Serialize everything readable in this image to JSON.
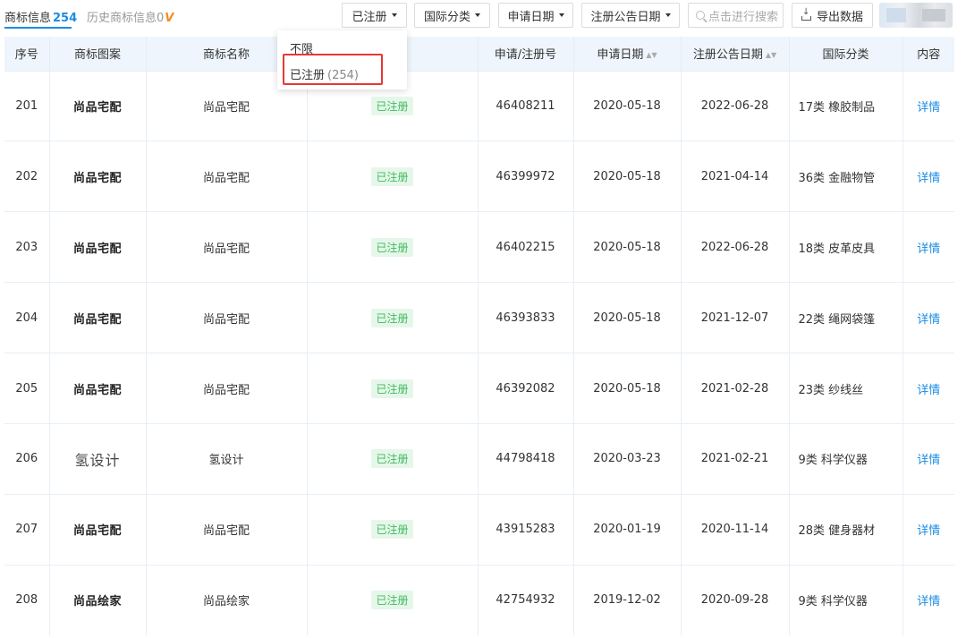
{
  "tabs": {
    "active_label": "商标信息",
    "active_count": "254",
    "history_label": "历史商标信息0",
    "vip_label": "V"
  },
  "toolbar": {
    "status_filter": "已注册",
    "class_filter": "国际分类",
    "apply_date_filter": "申请日期",
    "pub_date_filter": "注册公告日期",
    "search_placeholder": "点击进行搜索",
    "export_label": "导出数据"
  },
  "status_dropdown": {
    "options": [
      {
        "label": "不限",
        "count": ""
      },
      {
        "label": "已注册",
        "count": "(254)"
      }
    ]
  },
  "table": {
    "columns": [
      "序号",
      "商标图案",
      "商标名称",
      "状态",
      "申请/注册号",
      "申请日期",
      "注册公告日期",
      "国际分类",
      "内容"
    ],
    "status_col_visible": "态",
    "rows": [
      {
        "index": "201",
        "logo": "尚品宅配",
        "name": "尚品宅配",
        "status": "已注册",
        "reg_no": "46408211",
        "apply_date": "2020-05-18",
        "pub_date": "2022-06-28",
        "class": "17类 橡胶制品",
        "action": "详情"
      },
      {
        "index": "202",
        "logo": "尚品宅配",
        "name": "尚品宅配",
        "status": "已注册",
        "reg_no": "46399972",
        "apply_date": "2020-05-18",
        "pub_date": "2021-04-14",
        "class": "36类 金融物管",
        "action": "详情"
      },
      {
        "index": "203",
        "logo": "尚品宅配",
        "name": "尚品宅配",
        "status": "已注册",
        "reg_no": "46402215",
        "apply_date": "2020-05-18",
        "pub_date": "2022-06-28",
        "class": "18类 皮革皮具",
        "action": "详情"
      },
      {
        "index": "204",
        "logo": "尚品宅配",
        "name": "尚品宅配",
        "status": "已注册",
        "reg_no": "46393833",
        "apply_date": "2020-05-18",
        "pub_date": "2021-12-07",
        "class": "22类 绳网袋篷",
        "action": "详情"
      },
      {
        "index": "205",
        "logo": "尚品宅配",
        "name": "尚品宅配",
        "status": "已注册",
        "reg_no": "46392082",
        "apply_date": "2020-05-18",
        "pub_date": "2021-02-28",
        "class": "23类 纱线丝",
        "action": "详情"
      },
      {
        "index": "206",
        "logo": "氢设计",
        "name": "氢设计",
        "status": "已注册",
        "reg_no": "44798418",
        "apply_date": "2020-03-23",
        "pub_date": "2021-02-21",
        "class": "9类 科学仪器",
        "action": "详情"
      },
      {
        "index": "207",
        "logo": "尚品宅配",
        "name": "尚品宅配",
        "status": "已注册",
        "reg_no": "43915283",
        "apply_date": "2020-01-19",
        "pub_date": "2020-11-14",
        "class": "28类 健身器材",
        "action": "详情"
      },
      {
        "index": "208",
        "logo": "尚品绘家",
        "name": "尚品绘家",
        "status": "已注册",
        "reg_no": "42754932",
        "apply_date": "2019-12-02",
        "pub_date": "2020-09-28",
        "class": "9类 科学仪器",
        "action": "详情"
      }
    ]
  }
}
